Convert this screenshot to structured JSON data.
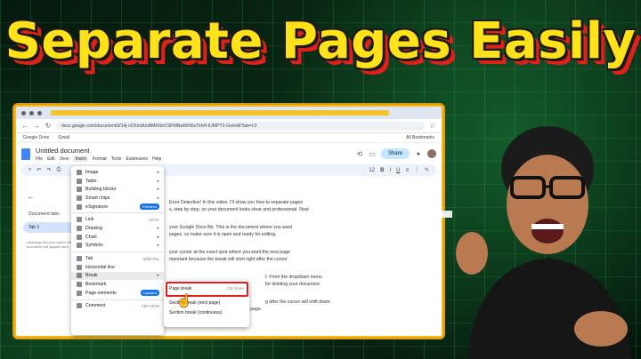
{
  "title": "Separate Pages Easily",
  "browser": {
    "url": "docs.google.com/document/d/14j-nCKmdUsBMRStrCSPhfBwhhN5xTkhH-IUMPY3-Go/edit?tab=t.0",
    "bookmarks": [
      "Google Drive",
      "Gmail"
    ],
    "all_bookmarks": "All Bookmarks"
  },
  "doc": {
    "title": "Untitled document",
    "menus": [
      "File",
      "Edit",
      "View",
      "Insert",
      "Format",
      "Tools",
      "Extensions",
      "Help"
    ],
    "share_label": "Share",
    "font_size": "12"
  },
  "sidebar": {
    "title": "Document tabs",
    "tab": "Tab 1",
    "note": "Headings that you add to the document will appear here."
  },
  "body_text": [
    "Error Detective! In this video, I'll show you how to separate pages",
    "s, step by step, so your document looks clear and professional. Now",
    "your Google Docs file. This is the document where you want",
    "pages, so make sure it is open and ready for editing.",
    "your cursor at the exact spot where you want the new page",
    "mportant because the break will start right after the cursor",
    "t: From the dropdown menu",
    "for dividing your document.",
    "g after the cursor will shift down",
    "and your content will continue on a brand-new page."
  ],
  "insert_menu": {
    "items": [
      {
        "label": "Image",
        "shortcut": "",
        "arrow": "▸"
      },
      {
        "label": "Table",
        "shortcut": "",
        "arrow": "▸"
      },
      {
        "label": "Building blocks",
        "shortcut": "",
        "arrow": "▸"
      },
      {
        "label": "Smart chips",
        "shortcut": "",
        "arrow": "▸"
      },
      {
        "label": "eSignature",
        "shortcut": "",
        "badge": "Premium"
      },
      {
        "label": "Link",
        "shortcut": "Ctrl+K",
        "arrow": ""
      },
      {
        "label": "Drawing",
        "shortcut": "",
        "arrow": "▸"
      },
      {
        "label": "Chart",
        "shortcut": "",
        "arrow": "▸"
      },
      {
        "label": "Symbols",
        "shortcut": "",
        "arrow": "▸"
      },
      {
        "label": "Tab",
        "shortcut": "Shift+F11",
        "arrow": ""
      },
      {
        "label": "Horizontal line",
        "shortcut": "",
        "arrow": ""
      },
      {
        "label": "Break",
        "shortcut": "",
        "arrow": "▸"
      },
      {
        "label": "Bookmark",
        "shortcut": "",
        "arrow": ""
      },
      {
        "label": "Page elements",
        "shortcut": "",
        "badge": "Updated"
      },
      {
        "label": "Comment",
        "shortcut": "Ctrl+Alt+M",
        "arrow": ""
      }
    ]
  },
  "break_submenu": {
    "items": [
      {
        "label": "Page break",
        "shortcut": "Ctrl+Enter"
      },
      {
        "label": "Section break (next page)",
        "shortcut": ""
      },
      {
        "label": "Section break (continuous)",
        "shortcut": ""
      }
    ]
  },
  "colors": {
    "title_fill": "#ffe21a",
    "title_shadow": "#e0201a",
    "highlight": "#e51d1d",
    "frame": "#f3b81f"
  }
}
